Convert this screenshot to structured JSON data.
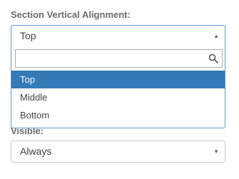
{
  "section_valign": {
    "label": "Section Vertical Alignment:",
    "value": "Top",
    "search_value": "",
    "options": [
      "Top",
      "Middle",
      "Bottom"
    ],
    "selected_index": 0
  },
  "visible": {
    "label": "Visible:",
    "value": "Always"
  },
  "icons": {
    "search": "search-icon",
    "dropdown_up": "caret-up-icon",
    "dropdown_down": "caret-down-icon"
  },
  "colors": {
    "highlight": "#337ab7",
    "focus_border": "#5b9bd1"
  }
}
